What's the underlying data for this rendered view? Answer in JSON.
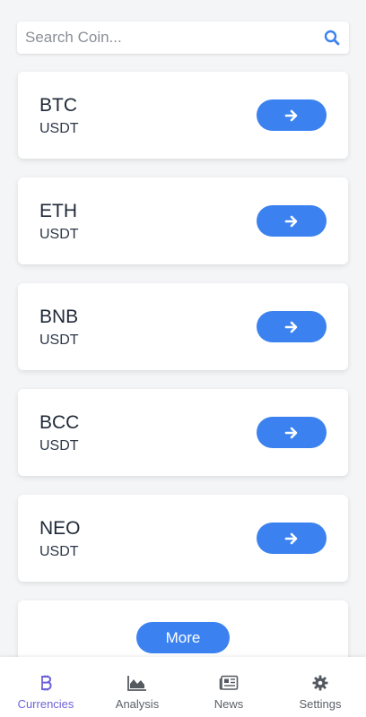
{
  "search": {
    "placeholder": "Search Coin...",
    "value": "",
    "icon": "search-icon"
  },
  "coins": [
    {
      "symbol": "BTC",
      "quote": "USDT",
      "action_icon": "arrow-right-icon"
    },
    {
      "symbol": "ETH",
      "quote": "USDT",
      "action_icon": "arrow-right-icon"
    },
    {
      "symbol": "BNB",
      "quote": "USDT",
      "action_icon": "arrow-right-icon"
    },
    {
      "symbol": "BCC",
      "quote": "USDT",
      "action_icon": "arrow-right-icon"
    },
    {
      "symbol": "NEO",
      "quote": "USDT",
      "action_icon": "arrow-right-icon"
    }
  ],
  "more": {
    "label": "More"
  },
  "bottom_nav": {
    "items": [
      {
        "label": "Currencies",
        "icon": "bitcoin-icon",
        "active": true
      },
      {
        "label": "Analysis",
        "icon": "area-chart-icon",
        "active": false
      },
      {
        "label": "News",
        "icon": "newspaper-icon",
        "active": false
      },
      {
        "label": "Settings",
        "icon": "gear-icon",
        "active": false
      }
    ]
  },
  "colors": {
    "accent": "#3b82f0",
    "active_nav": "#6d63d8",
    "background": "#f4f5f7",
    "card": "#ffffff"
  }
}
